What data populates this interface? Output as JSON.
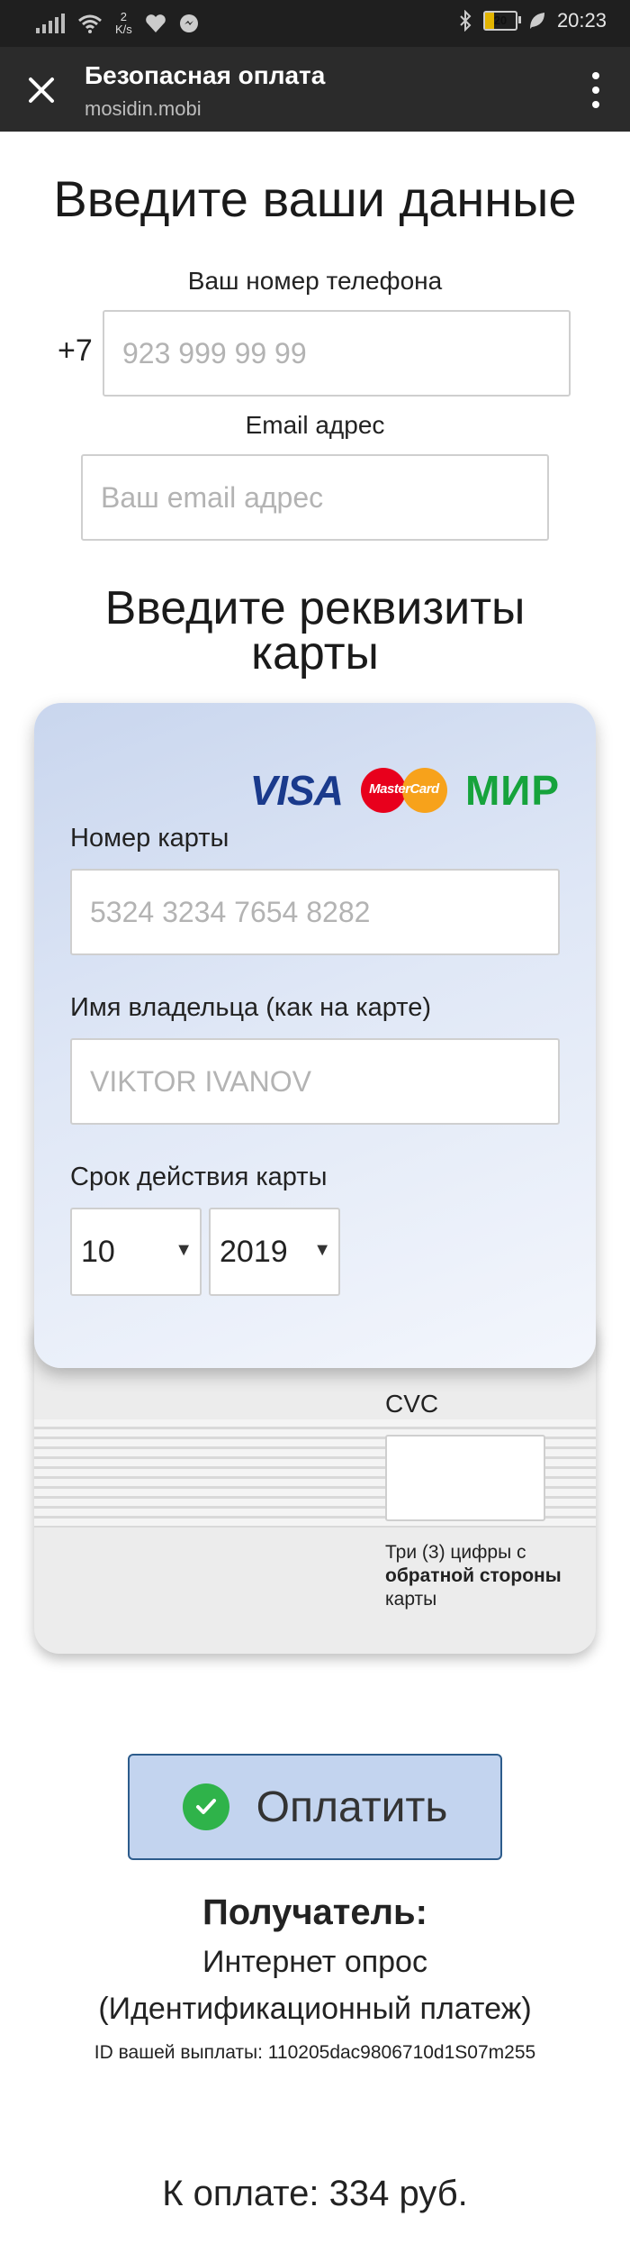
{
  "status_bar": {
    "speed_value": "2",
    "speed_unit": "K/s",
    "battery": "20",
    "time": "20:23"
  },
  "browser": {
    "title": "Безопасная оплата",
    "url": "mosidin.mobi"
  },
  "contact": {
    "heading": "Введите ваши данные",
    "phone_label": "Ваш номер телефона",
    "phone_prefix": "+7",
    "phone_placeholder": "923 999 99 99",
    "email_label": "Email адрес",
    "email_placeholder": "Ваш email адрес"
  },
  "card": {
    "heading_line1": "Введите реквизиты",
    "heading_line2": "карты",
    "logos": {
      "visa": "VISA",
      "mastercard": "MasterCard",
      "mir": "МИР"
    },
    "number_label": "Номер карты",
    "number_placeholder": "5324 3234 7654 8282",
    "holder_label": "Имя владельца (как на карте)",
    "holder_placeholder": "VIKTOR IVANOV",
    "expiry_label": "Срок действия карты",
    "expiry_month": "10",
    "expiry_year": "2019",
    "cvc_label": "CVC",
    "cvc_help_1": "Три (3) цифры с",
    "cvc_help_2": "обратной стороны",
    "cvc_help_3": "карты"
  },
  "pay": {
    "button_label": "Оплатить",
    "recipient_heading": "Получатель:",
    "recipient_name": "Интернет опрос",
    "recipient_type": "(Идентификационный платеж)",
    "payment_id": "ID вашей выплаты: 110205dac9806710d1S07m255",
    "amount": "К оплате: 334 руб."
  },
  "colors": {
    "check": "#2fb34a",
    "mir": "#16a33c",
    "visa": "#1a3a8c",
    "button_bg": "#c3d4ef"
  }
}
